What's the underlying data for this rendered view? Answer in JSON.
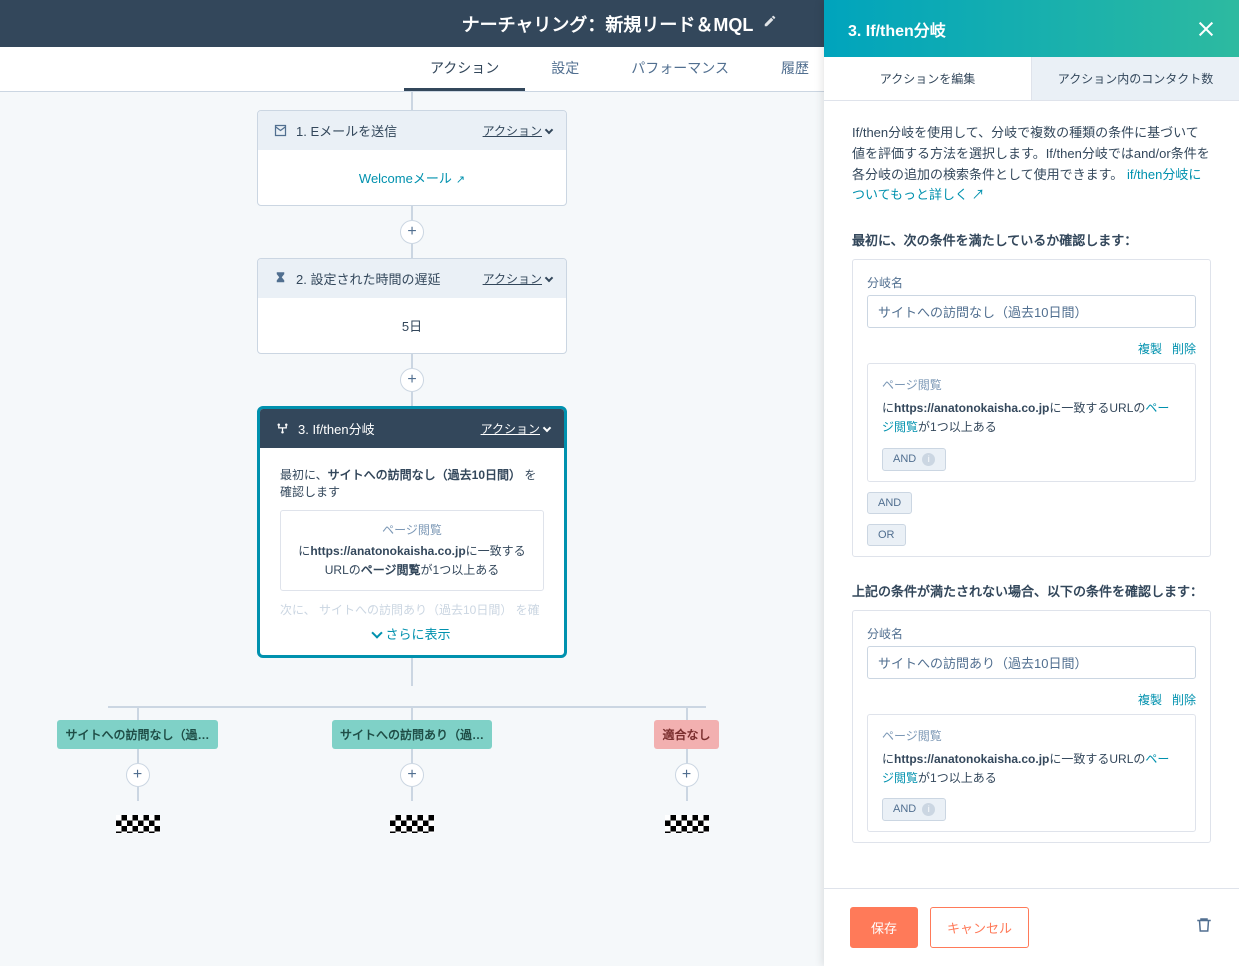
{
  "header": {
    "title": "ナーチャリング：新規リード＆MQL"
  },
  "tabs": [
    "アクション",
    "設定",
    "パフォーマンス",
    "履歴"
  ],
  "cards": {
    "c1": {
      "step": "1. Eメールを送信",
      "action": "アクション",
      "body_link": "Welcomeメール"
    },
    "c2": {
      "step": "2. 設定された時間の遅延",
      "action": "アクション",
      "body": "5日"
    },
    "c3": {
      "step": "3. If/then分岐",
      "action": "アクション",
      "line_pre": "最初に、",
      "line_bold": "サイトへの訪問なし（過去10日間）",
      "line_post": " を確認します",
      "inner_label": "ページ閲覧",
      "inner_text_pre": "に",
      "inner_url": "https://anatonokaisha.co.jp",
      "inner_text_mid": "に一致するURLの",
      "inner_link": "ページ閲覧",
      "inner_text_post": "が1つ以上ある",
      "truncated": "次に、 サイトへの訪問あり（過去10日間） を確",
      "show_more": "さらに表示"
    }
  },
  "branches": {
    "b1": "サイトへの訪問なし（過…",
    "b2": "サイトへの訪問あり（過…",
    "b3": "適合なし"
  },
  "panel": {
    "title": "3. If/then分岐",
    "subtabs": [
      "アクションを編集",
      "アクション内のコンタクト数"
    ],
    "desc": "If/then分岐を使用して、分岐で複数の種類の条件に基づいて値を評価する方法を選択します。If/then分岐ではand/or条件を各分岐の追加の検索条件として使用できます。",
    "desc_link": "if/then分岐についてもっと詳しく",
    "section1": "最初に、次の条件を満たしているか確認します：",
    "branch_name_label": "分岐名",
    "branch1_value": "サイトへの訪問なし（過去10日間）",
    "dup": "複製",
    "del": "削除",
    "pv_label": "ページ閲覧",
    "cond_pre": "に",
    "cond_url": "https://anatonokaisha.co.jp",
    "cond_mid": "に一致するURLの",
    "cond_link": "ページ閲覧",
    "cond_post": "が1つ以上ある",
    "and": "AND",
    "or": "OR",
    "section2": "上記の条件が満たされない場合、以下の条件を確認します：",
    "branch2_value": "サイトへの訪問あり（過去10日間）",
    "footer": {
      "save": "保存",
      "cancel": "キャンセル"
    }
  }
}
